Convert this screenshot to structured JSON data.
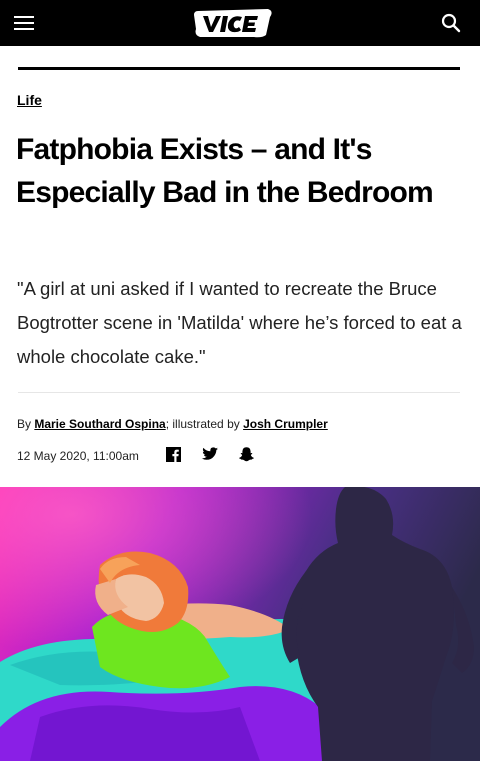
{
  "header": {
    "logo_text": "VICE",
    "menu_icon": "hamburger-menu-icon",
    "search_icon": "search-icon",
    "background": "#000000"
  },
  "article": {
    "section": "Life",
    "headline": "Fatphobia Exists – and It's Especially Bad in the Bedroom",
    "dek": "\"A girl at uni asked if I wanted to recreate the Bruce Bogtrotter scene in 'Matilda' where he’s forced to eat a whole chocolate cake.\"",
    "byline": {
      "by": "By ",
      "author": "Marie Southard Ospina",
      "separator": "; illustrated by ",
      "illustrator": "Josh Crumpler"
    },
    "date": "12 May 2020, 11:00am",
    "share_icons": [
      "facebook-icon",
      "twitter-icon",
      "snapchat-icon"
    ]
  },
  "hero_image": {
    "colors": [
      "#ff2fb3",
      "#7b2cf0",
      "#3a2f6e",
      "#6ee61f",
      "#2dd6c6",
      "#f07a3a"
    ]
  }
}
